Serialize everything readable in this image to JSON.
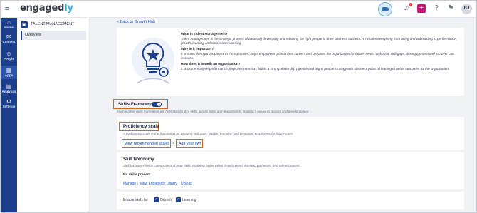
{
  "app": {
    "logo": "engaged",
    "logo_accent": "ly"
  },
  "topbar": {
    "avatar_initials": "BJ",
    "plus_symbol": "+"
  },
  "rail": [
    {
      "label": "Home",
      "icon": "home-icon",
      "glyph": "⌂"
    },
    {
      "label": "Connect",
      "icon": "chat-icon",
      "glyph": "✉"
    },
    {
      "label": "People",
      "icon": "people-icon",
      "glyph": "☺"
    },
    {
      "label": "Apps",
      "icon": "apps-icon",
      "glyph": "▦"
    },
    {
      "label": "Analytics",
      "icon": "analytics-icon",
      "glyph": "▤"
    },
    {
      "label": "Settings",
      "icon": "gear-icon",
      "glyph": "⚙"
    }
  ],
  "sidebar": {
    "title": "TALENT MANAGEMENT",
    "items": [
      {
        "label": "Overview"
      }
    ]
  },
  "main": {
    "back_link": "< Back to Growth Hub",
    "intro": [
      {
        "q": "What is Talent Management?",
        "a": "Talent management is the strategic process of attracting developing and retaining the right people to drive business success. It includes everything from hiring and onboarding to performance, growth, learning and succession planning."
      },
      {
        "q": "Why is it important?",
        "a": "It ensures the right people are in the right roles, helps employees grow in their careers and prepares the organization for future needs. Without it, skill gaps, disengagement and turnover can increase."
      },
      {
        "q": "How does it benefit an organization?",
        "a": "It boosts employee performance, improves retention, builds a strong leadership pipeline and aligns people strategy with business goals all leading to better outcomes for the organization."
      }
    ],
    "skills_framework": {
      "label": "Skills Framework",
      "enabled": true,
      "description": "Enabling the skills framework will help standardize skills across roles and departments, making it easier to assess and develop talent."
    },
    "proficiency": {
      "title": "Proficiency scale",
      "description": "A proficiency scale is the foundation for bridging skill gaps, guiding learning, and preparing employees for future roles.",
      "btn_recommended": "View recommended scales",
      "or": "or",
      "btn_own": "Add your own"
    },
    "taxonomy": {
      "title": "Skill taxonomy",
      "description": "Skill taxonomy helps categorize and map skills, enabling better talent development, learning pathways, and role alignment.",
      "empty": "No skills present",
      "links": [
        "Manage",
        "View Engagedly Library",
        "Upload"
      ]
    },
    "enable": {
      "label": "Enable skills for",
      "options": [
        {
          "label": "Growth",
          "checked": true
        },
        {
          "label": "Learning",
          "checked": true
        }
      ]
    }
  },
  "colors": {
    "nav": "#1c3f8c",
    "highlight": "#d2691e",
    "link": "#1d5bc9"
  }
}
